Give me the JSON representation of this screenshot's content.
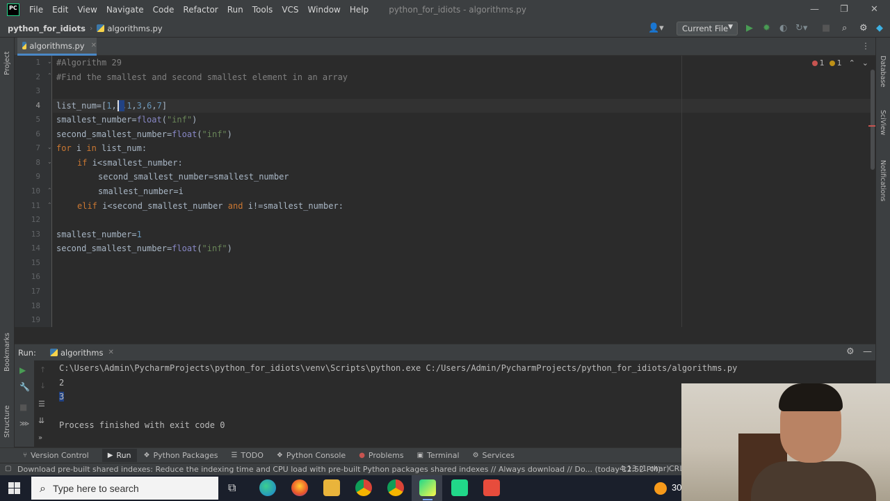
{
  "app": {
    "logo_text": "PC",
    "menu": [
      "File",
      "Edit",
      "View",
      "Navigate",
      "Code",
      "Refactor",
      "Run",
      "Tools",
      "VCS",
      "Window",
      "Help"
    ],
    "window_title": "python_for_idiots - algorithms.py"
  },
  "navbar": {
    "project": "python_for_idiots",
    "file": "algorithms.py",
    "run_config": "Current File"
  },
  "left_strip": {
    "project_label": "Project",
    "bookmarks_label": "Bookmarks",
    "structure_label": "Structure"
  },
  "right_strip": {
    "database_label": "Database",
    "sciview_label": "SciView",
    "notifications_label": "Notifications"
  },
  "editor": {
    "tab_label": "algorithms.py",
    "inspections": {
      "errors": "1",
      "warnings": "1"
    },
    "line_numbers": [
      "1",
      "2",
      "3",
      "4",
      "5",
      "6",
      "7",
      "8",
      "9",
      "10",
      "11",
      "12",
      "13",
      "14",
      "15",
      "16",
      "17",
      "18",
      "19"
    ],
    "lines": {
      "l1": "#Algorithm 29",
      "l2": "#Find the smallest and second smallest element in an array",
      "l4_a": "list_num=[",
      "l4_b": "1",
      "l4_c": ",",
      "l4_d": "2",
      "l4_e": ",",
      "l4_f": "1",
      "l4_g": ",",
      "l4_h": "3",
      "l4_i": ",",
      "l4_j": "6",
      "l4_k": ",",
      "l4_l": "7",
      "l4_m": "]",
      "l5_a": "smallest_number=",
      "l5_b": "float",
      "l5_c": "(",
      "l5_d": "\"inf\"",
      "l5_e": ")",
      "l6_a": "second_smallest_number=",
      "l6_b": "float",
      "l6_c": "(",
      "l6_d": "\"inf\"",
      "l6_e": ")",
      "l7_a": "for",
      "l7_b": " i ",
      "l7_c": "in",
      "l7_d": " list_num:",
      "l8_a": "if",
      "l8_b": " i<smallest_number:",
      "l9": "second_smallest_number=smallest_number",
      "l10": "smallest_number=i",
      "l11_a": "elif",
      "l11_b": " i<second_smallest_number ",
      "l11_c": "and",
      "l11_d": " i!=smallest_number:",
      "l13_a": "smallest_number=",
      "l13_b": "1",
      "l14_a": "second_smallest_number=",
      "l14_b": "float",
      "l14_c": "(",
      "l14_d": "\"inf\"",
      "l14_e": ")"
    }
  },
  "run_panel": {
    "label": "Run:",
    "tab": "algorithms",
    "console": {
      "command": "C:\\Users\\Admin\\PycharmProjects\\python_for_idiots\\venv\\Scripts\\python.exe C:/Users/Admin/PycharmProjects/python_for_idiots/algorithms.py",
      "out1": "2",
      "out2": "3",
      "finished": "Process finished with exit code 0"
    }
  },
  "bottom_tabs": [
    "Version Control",
    "Run",
    "Python Packages",
    "TODO",
    "Python Console",
    "Problems",
    "Terminal",
    "Services"
  ],
  "statusbar": {
    "message": "Download pre-built shared indexes: Reduce the indexing time and CPU load with pre-built Python packages shared indexes // Always download // Do... (today 12:52 PM)",
    "position": "4:13 (1 char)",
    "line_sep": "CRL"
  },
  "taskbar": {
    "search_placeholder": "Type here to search",
    "temp": "30"
  },
  "colors": {
    "keyword": "#cc7832",
    "number": "#6897bb",
    "string": "#6a8759",
    "comment": "#808080",
    "run_green": "#499c54"
  }
}
